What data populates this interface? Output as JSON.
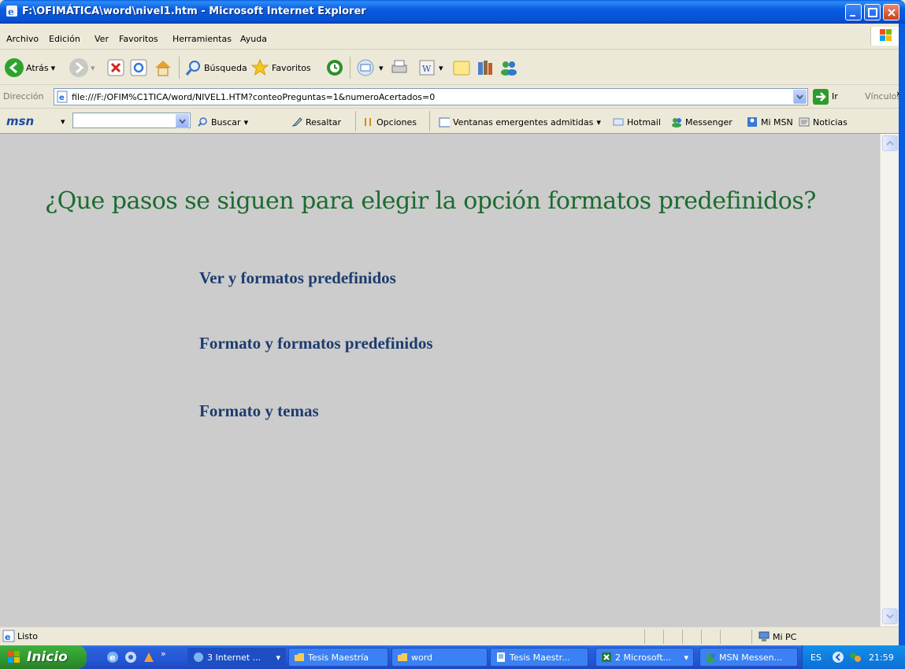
{
  "window": {
    "title": "F:\\OFIMÁTICA\\word\\nivel1.htm - Microsoft Internet Explorer"
  },
  "menu": [
    "Archivo",
    "Edición",
    "Ver",
    "Favoritos",
    "Herramientas",
    "Ayuda"
  ],
  "toolbar": {
    "back": "Atrás",
    "search": "Búsqueda",
    "favorites": "Favoritos"
  },
  "address": {
    "label": "Dirección",
    "url": "file:///F:/OFIM%C1TICA/word/NIVEL1.HTM?conteoPreguntas=1&numeroAcertados=0",
    "go": "Ir",
    "links": "Vínculos"
  },
  "msn": {
    "logo": "msn",
    "search": "Buscar",
    "highlight": "Resaltar",
    "options": "Opciones",
    "popups": "Ventanas emergentes admitidas",
    "hotmail": "Hotmail",
    "messenger": "Messenger",
    "mymsn": "Mi MSN",
    "news": "Noticias"
  },
  "page": {
    "question": "¿Que pasos se siguen para elegir la opción formatos predefinidos?",
    "options": [
      "Ver y formatos predefinidos",
      "Formato y formatos predefinidos",
      "Formato y temas"
    ]
  },
  "status": {
    "text": "Listo",
    "zone": "Mi PC"
  },
  "taskbar": {
    "start": "Inicio",
    "tasks": [
      "3 Internet ...",
      "Tesis Maestría",
      "word",
      "Tesis Maestr...",
      "2 Microsoft...",
      "MSN Messen..."
    ],
    "lang": "ES",
    "clock": "21:59"
  }
}
